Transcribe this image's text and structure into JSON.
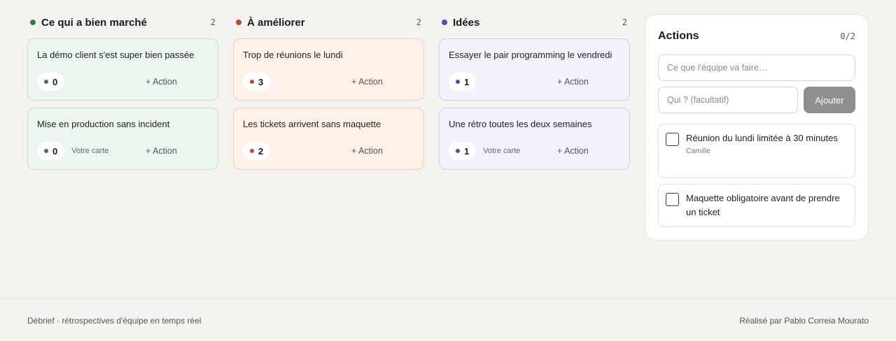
{
  "colors": {
    "green": "#2f7d4f",
    "red": "#c0483a",
    "blue": "#4a4bbd",
    "button_disabled": "#8f8f8f"
  },
  "columns": [
    {
      "title": "Ce qui a bien marché",
      "count": "2",
      "cards": [
        {
          "text": "La démo client s'est super bien passée",
          "votes": "0",
          "mine": "",
          "action": "+ Action"
        },
        {
          "text": "Mise en production sans incident",
          "votes": "0",
          "mine": "Votre carte",
          "action": "+ Action"
        }
      ]
    },
    {
      "title": "À améliorer",
      "count": "2",
      "cards": [
        {
          "text": "Trop de réunions le lundi",
          "votes": "3",
          "mine": "",
          "action": "+ Action"
        },
        {
          "text": "Les tickets arrivent sans maquette",
          "votes": "2",
          "mine": "",
          "action": "+ Action"
        }
      ]
    },
    {
      "title": "Idées",
      "count": "2",
      "cards": [
        {
          "text": "Essayer le pair programming le vendredi",
          "votes": "1",
          "mine": "",
          "action": "+ Action"
        },
        {
          "text": "Une rétro toutes les deux semaines",
          "votes": "1",
          "mine": "Votre carte",
          "action": "+ Action"
        }
      ]
    }
  ],
  "actions_panel": {
    "title": "Actions",
    "count": "0/2",
    "what_placeholder": "Ce que l'équipe va faire…",
    "who_placeholder": "Qui ? (facultatif)",
    "add_label": "Ajouter",
    "items": [
      {
        "text": "Réunion du lundi limitée à 30 minutes",
        "owner": "Camille",
        "done": false
      },
      {
        "text": "Maquette obligatoire avant de prendre un ticket",
        "owner": "",
        "done": false
      }
    ]
  },
  "footer": {
    "left": "Débrief · rétrospectives d'équipe en temps réel",
    "right": "Réalisé par Pablo Correia Mourato"
  }
}
